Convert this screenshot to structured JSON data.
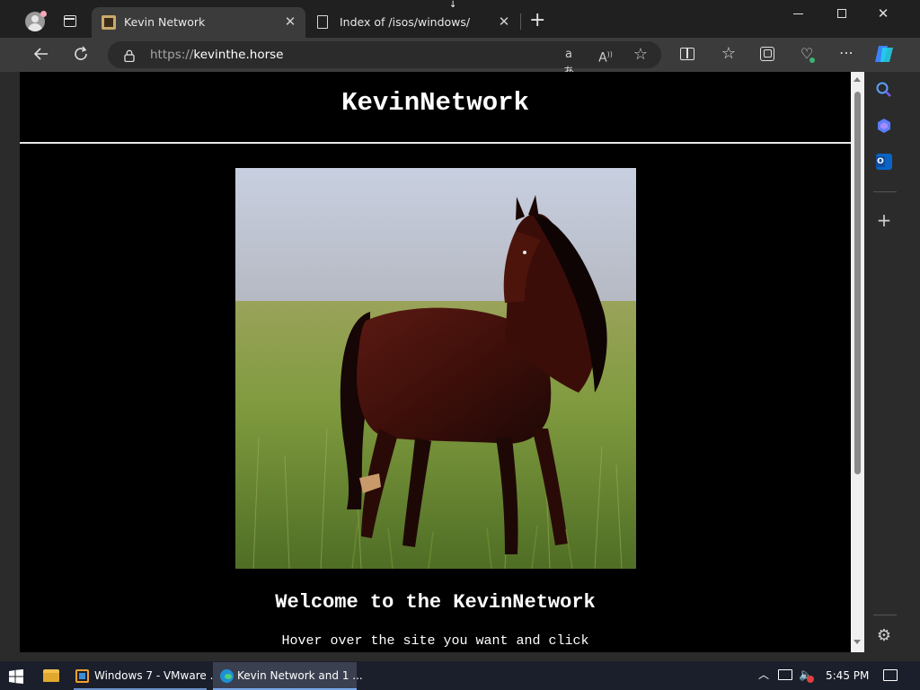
{
  "tabs": [
    {
      "title": "Kevin Network",
      "active": true
    },
    {
      "title": "Index of /isos/windows/",
      "active": false
    }
  ],
  "address": {
    "scheme": "https://",
    "host": "kevinthe.horse"
  },
  "page": {
    "site_title": "KevinNetwork",
    "welcome": "Welcome to the KevinNetwork",
    "hover_text": "Hover over the site you want and click"
  },
  "taskbar": {
    "apps": [
      {
        "label": "Windows 7 - VMware ..."
      },
      {
        "label": "Kevin Network and 1 ..."
      }
    ],
    "clock": "5:45 PM"
  },
  "icons": {
    "profile": "profile-avatar-icon",
    "tab_actions": "tab-actions-icon",
    "back": "back-arrow-icon",
    "refresh": "refresh-icon",
    "lock": "lock-icon",
    "read_aloud": "read-aloud-icon",
    "translate": "translate-icon",
    "favorite": "star-icon",
    "split": "split-screen-icon",
    "favorites": "favorites-icon",
    "collections": "collections-icon",
    "performance": "heart-pulse-icon",
    "more": "more-icon",
    "copilot": "copilot-icon",
    "search": "search-icon",
    "outlook": "outlook-icon",
    "add": "plus-icon",
    "settings": "gear-icon"
  },
  "colors": {
    "page_bg": "#000000",
    "chrome_dark": "#202020",
    "toolbar": "#3b3b3b",
    "taskbar": "#1b1f2b"
  }
}
